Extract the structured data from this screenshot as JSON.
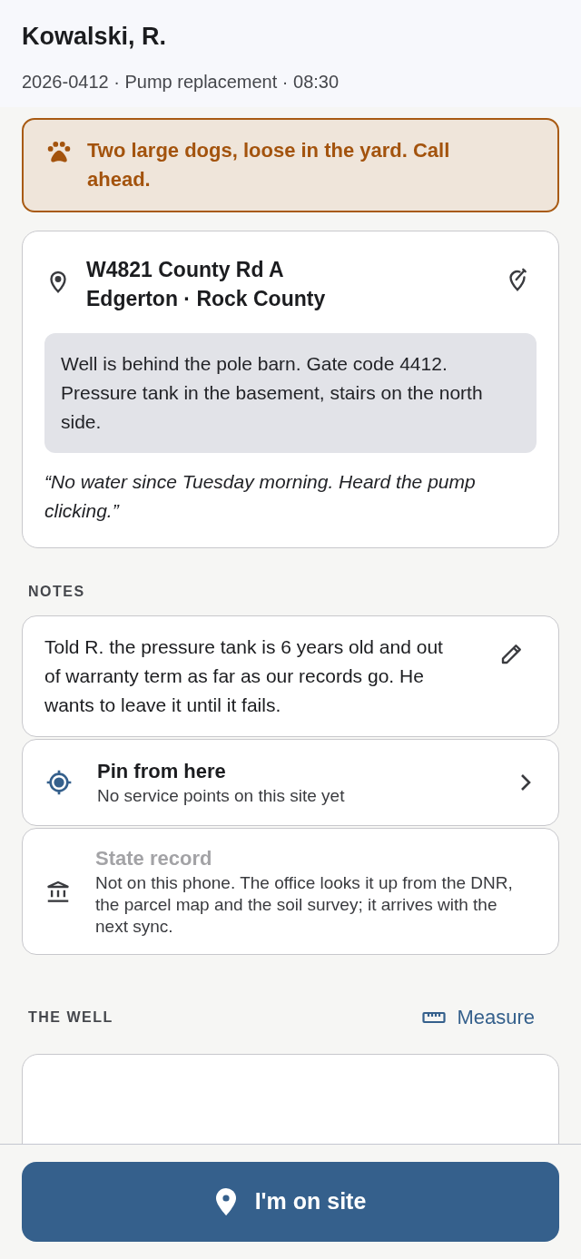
{
  "header": {
    "title": "Kowalski, R.",
    "subtitle": "2026-0412 · Pump replacement · 08:30"
  },
  "alert": {
    "text": "Two large dogs, loose in the yard. Call ahead."
  },
  "site": {
    "address_line": "W4821 County Rd A",
    "locality": "Edgerton · Rock County",
    "directions": "Well is behind the pole barn. Gate code 4412. Pressure tank in the basement, stairs on the north side.",
    "complaint": "“No water since Tuesday morning. Heard the pump clicking.”"
  },
  "notes": {
    "heading": "NOTES",
    "text": "Told R. the pressure tank is 6 years old and out of warranty term as far as our records go. He wants to leave it until it fails."
  },
  "rows": [
    {
      "kind": "pin",
      "title": "Pin from here",
      "detail": "No service points on this site yet",
      "disabled": false
    },
    {
      "kind": "record",
      "title": "State record",
      "detail": "Not on this phone. The office looks it up from the DNR, the parcel map and the soil survey; it arrives with the next sync.",
      "disabled": true
    }
  ],
  "well": {
    "heading": "THE WELL",
    "action": "Measure"
  },
  "primary_button": {
    "label": "I'm on site"
  }
}
